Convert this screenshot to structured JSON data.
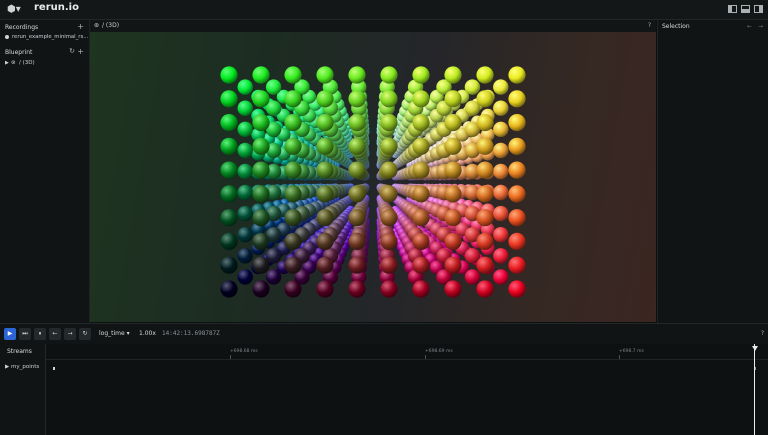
{
  "app": {
    "title": "rerun.io",
    "logo_icon": "rerun-logo-icon"
  },
  "left_panel": {
    "recordings_title": "Recordings",
    "recording_item": "rerun_example_minimal_rs...",
    "blueprint_title": "Blueprint",
    "blueprint_item": "/ (3D)"
  },
  "view": {
    "title": "/ (3D)",
    "help": "?"
  },
  "selection": {
    "title": "Selection",
    "back": "←",
    "forward": "→"
  },
  "time_controls": {
    "timeline": "log_time ▾",
    "speed": "1.00x",
    "current_time": "14:42:13.698787Z",
    "help": "?"
  },
  "streams": {
    "title": "Streams",
    "entity": "my_points"
  },
  "timeline_ticks": [
    "+698.68 ms",
    "+698.69 ms",
    "+698.7 ms"
  ],
  "colors": {
    "accent": "#2c66d6",
    "background": "#0d1011"
  }
}
